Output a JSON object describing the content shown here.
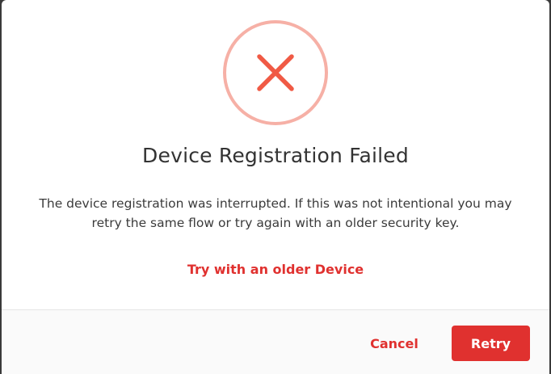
{
  "dialog": {
    "title": "Device Registration Failed",
    "message": "The device registration was interrupted. If this was not intentional you may retry the same flow or try again with an older security key.",
    "alt_link": "Try with an older Device",
    "icon": "error-x-icon"
  },
  "actions": {
    "cancel_label": "Cancel",
    "retry_label": "Retry"
  },
  "colors": {
    "accent": "#e0312f",
    "ring": "#f6b0a6",
    "x_mark": "#f05a45"
  }
}
